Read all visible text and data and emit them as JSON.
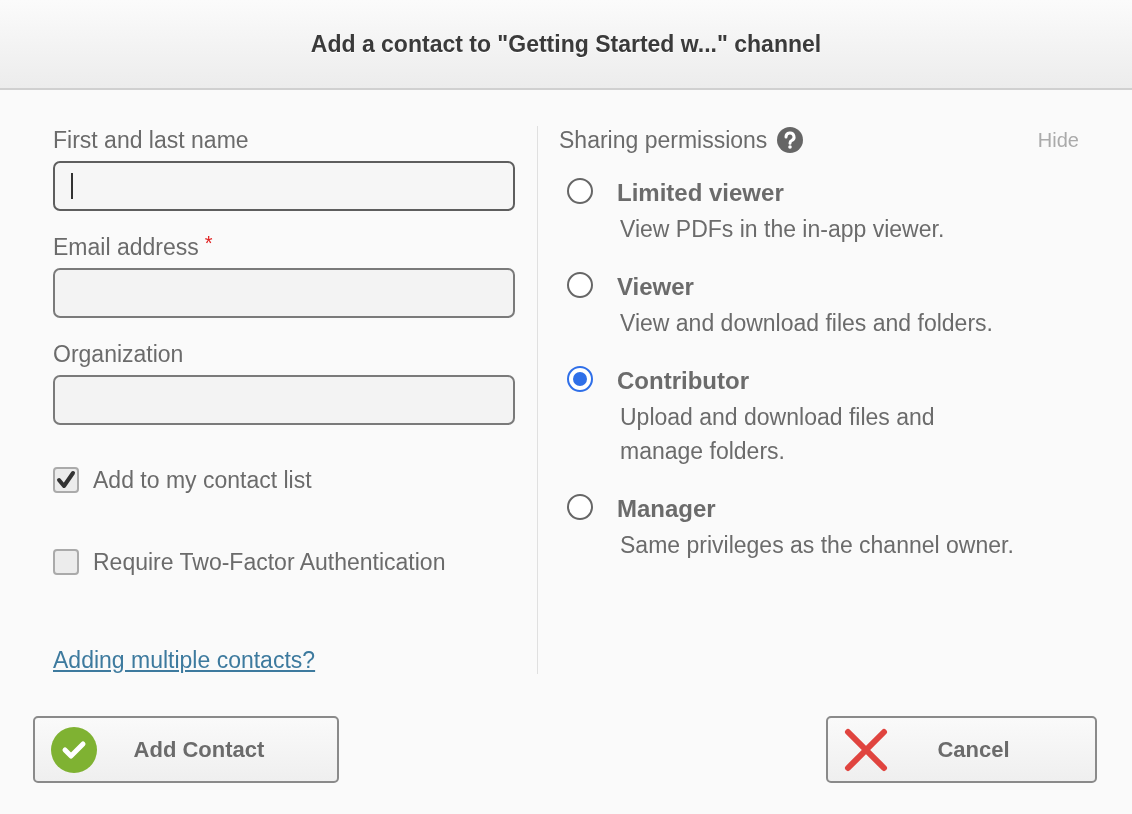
{
  "dialog": {
    "title": "Add a contact to \"Getting Started w...\" channel"
  },
  "fields": [
    {
      "label": "First and last name",
      "focused": true
    },
    {
      "label": "Email address",
      "required_mark": "*",
      "focused": false
    },
    {
      "label": "Organization",
      "focused": false
    }
  ],
  "checkboxes": [
    {
      "label": "Add to my contact list",
      "checked": true
    },
    {
      "label": "Require Two-Factor Authentication",
      "checked": false
    }
  ],
  "multiple_link": "Adding multiple contacts?",
  "permissions": {
    "heading": "Sharing permissions",
    "hide_link": "Hide",
    "options": [
      {
        "title": "Limited viewer",
        "description": "View PDFs in the in-app viewer.",
        "selected": false
      },
      {
        "title": "Viewer",
        "description": "View and download files and folders.",
        "selected": false
      },
      {
        "title": "Contributor",
        "description": "Upload and download files and manage folders.",
        "selected": true
      },
      {
        "title": "Manager",
        "description": "Same privileges as the channel owner.",
        "selected": false
      }
    ]
  },
  "buttons": [
    {
      "kind": "confirm",
      "label": "Add Contact"
    },
    {
      "kind": "cancel",
      "label": "Cancel"
    }
  ]
}
